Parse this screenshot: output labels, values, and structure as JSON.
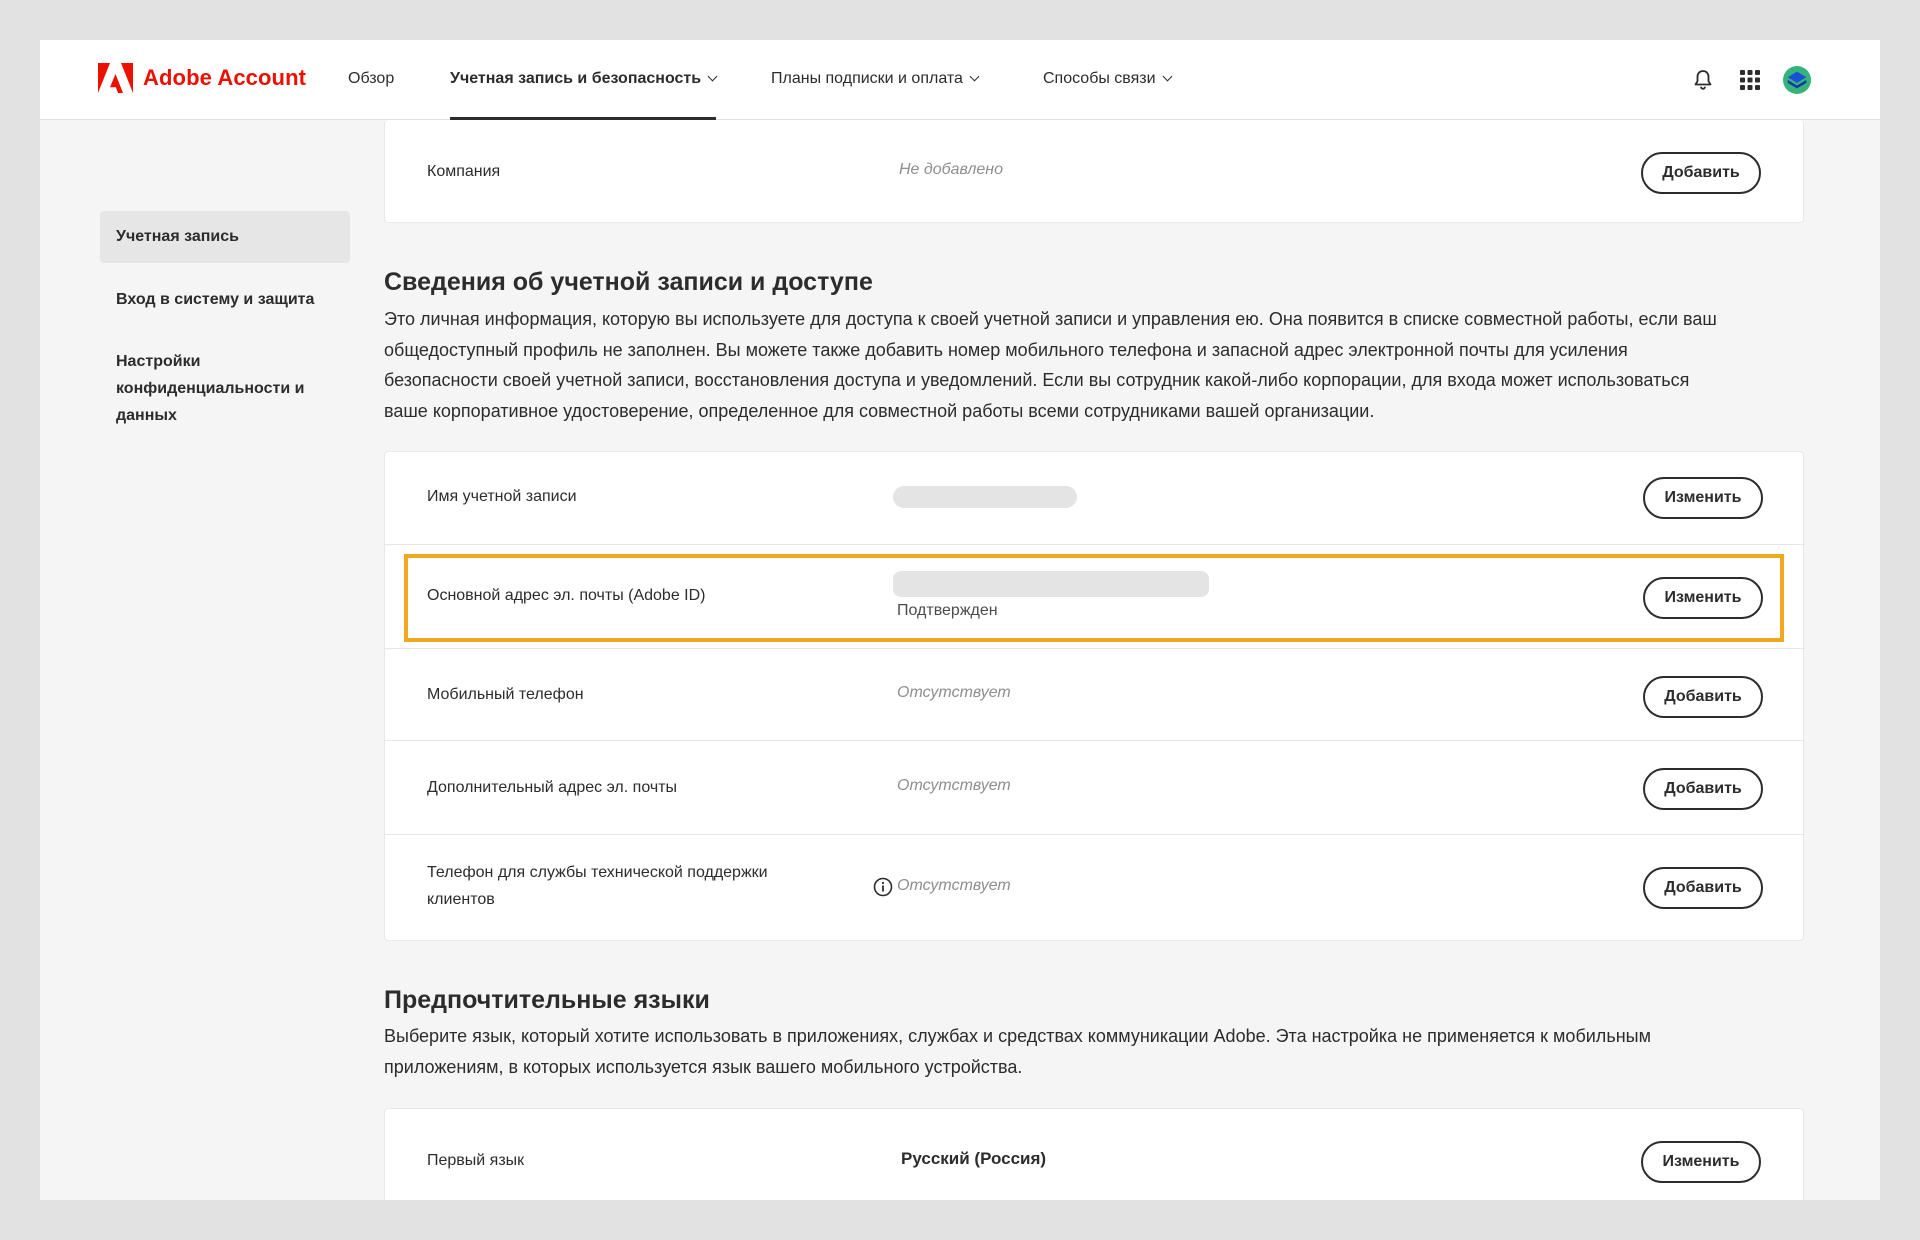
{
  "header": {
    "brand": "Adobe Account",
    "nav": [
      {
        "label": "Обзор"
      },
      {
        "label": "Учетная запись и безопасность"
      },
      {
        "label": "Планы подписки и оплата"
      },
      {
        "label": "Способы связи"
      }
    ],
    "icons": [
      "bell-icon",
      "app-grid-icon",
      "avatar"
    ]
  },
  "sidebar": {
    "items": [
      {
        "label": "Учетная запись"
      },
      {
        "label": "Вход в систему и защита"
      },
      {
        "label": "Настройки конфиденциальности и данных"
      }
    ]
  },
  "company_card": {
    "label": "Компания",
    "value": "Не добавлено",
    "button": "Добавить"
  },
  "account_section": {
    "title": "Сведения об учетной записи и доступе",
    "description_lines": [
      "Это личная информация, которую вы используете для доступа к своей учетной записи и управления ею. Она появится в списке совместной работы, если ваш",
      "общедоступный профиль не заполнен. Вы можете также добавить номер мобильного телефона и запасной адрес электронной почты для усиления",
      "безопасности своей учетной записи, восстановления доступа и уведомлений. Если вы сотрудник какой-либо корпорации, для входа может использоваться",
      "ваше корпоративное удостоверение, определенное для совместной работы всеми сотрудниками вашей организации."
    ],
    "rows": [
      {
        "label": "Имя учетной записи",
        "button": "Изменить"
      },
      {
        "label": "Основной адрес эл. почты (Adobe ID)",
        "status": "Подтвержден",
        "button": "Изменить"
      },
      {
        "label": "Мобильный телефон",
        "value": "Отсутствует",
        "button": "Добавить"
      },
      {
        "label": "Дополнительный адрес эл. почты",
        "value": "Отсутствует",
        "button": "Добавить"
      },
      {
        "label_line1": "Телефон для службы технической поддержки",
        "label_line2": "клиентов",
        "value": "Отсутствует",
        "button": "Добавить"
      }
    ]
  },
  "languages_section": {
    "title": "Предпочтительные языки",
    "description_lines": [
      "Выберите язык, который хотите использовать в приложениях, службах и средствах коммуникации Adobe. Эта настройка не применяется к мобильным",
      "приложениям, в которых используется язык вашего мобильного устройства."
    ],
    "row": {
      "label": "Первый язык",
      "value": "Русский (Россия)",
      "button": "Изменить"
    }
  },
  "colors": {
    "brand_red": "#eb1000",
    "highlight": "#f0a81f"
  }
}
